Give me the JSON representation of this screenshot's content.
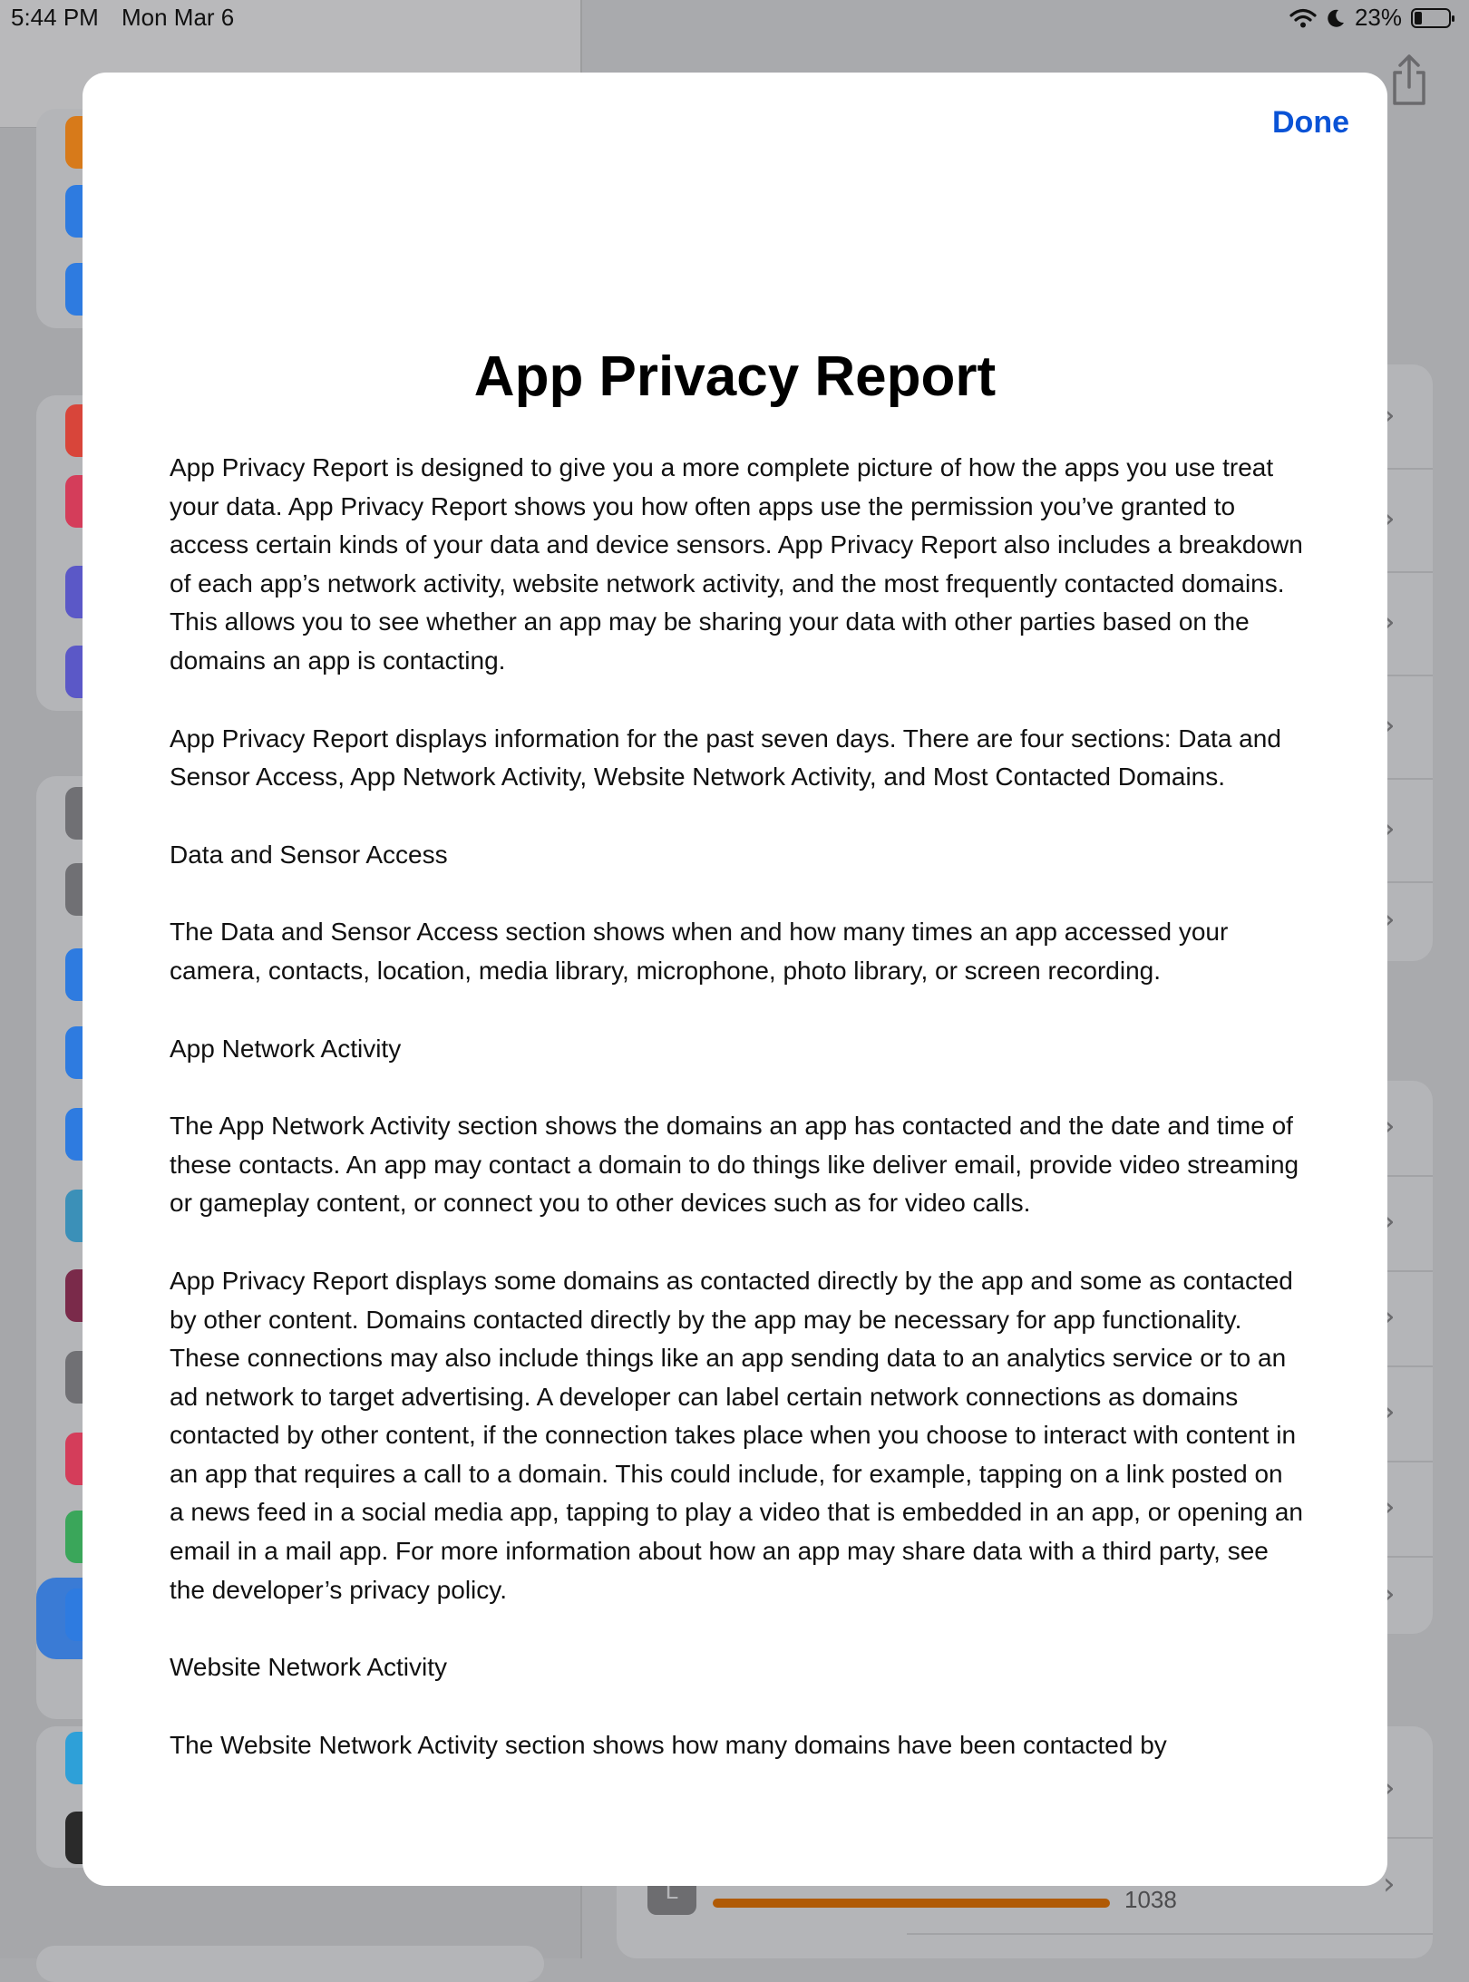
{
  "status_bar": {
    "time": "5:44 PM",
    "date": "Mon Mar 6",
    "battery_percent": "23%",
    "battery_level": 0.23
  },
  "modal": {
    "done_label": "Done",
    "title": "App Privacy Report",
    "paragraphs": [
      "App Privacy Report is designed to give you a more complete picture of how the apps you use treat your data. App Privacy Report shows you how often apps use the permission you’ve granted to access certain kinds of your data and device sensors. App Privacy Report also includes a breakdown of each app’s network activity, website network activity, and the most frequently contacted domains. This allows you to see whether an app may be sharing your data with other parties based on the domains an app is contacting.",
      "App Privacy Report displays information for the past seven days. There are four sections: Data and Sensor Access, App Network Activity, Website Network Activity, and Most Contacted Domains.",
      "Data and Sensor Access",
      "The Data and Sensor Access section shows when and how many times an app accessed your camera, contacts, location, media library, microphone, photo library, or screen recording.",
      "App Network Activity",
      "The App Network Activity section shows the domains an app has contacted and the date and time of these contacts. An app may contact a domain to do things like deliver email, provide video streaming or gameplay content, or connect you to other devices such as for video calls.",
      "App Privacy Report displays some domains as contacted directly by the app and some as contacted by other content. Domains contacted directly by the app may be necessary for app functionality. These connections may also include things like an app sending data to an analytics service or to an ad network to target advertising. A developer can label certain network connections as domains contacted by other content, if the connection takes place when you choose to interact with content in an app that requires a call to a domain. This could include, for example, tapping on a link posted on a news feed in a social media app, tapping to play a video that is embedded in an app, or opening an email in a mail app. For more information about how an app may share data with a third party, see the developer’s privacy policy.",
      "Website Network Activity",
      "The Website Network Activity section shows how many domains have been contacted by"
    ]
  },
  "background": {
    "visible_count": "1038",
    "icon_colors": [
      "#d77a1a",
      "#2e7be0",
      "#2e7be0",
      "#d8453a",
      "#d43d5a",
      "#5b58c7",
      "#5b58c7",
      "#707074",
      "#707074",
      "#2e7be0",
      "#2e7be0",
      "#2e7be0",
      "#3b90b8",
      "#7a2a4a",
      "#707074",
      "#d43d5a",
      "#3aa65a",
      "#2e7be0",
      "#2ea0d8",
      "#2a2a2a"
    ],
    "accent_bar_color": "#b05a05"
  }
}
